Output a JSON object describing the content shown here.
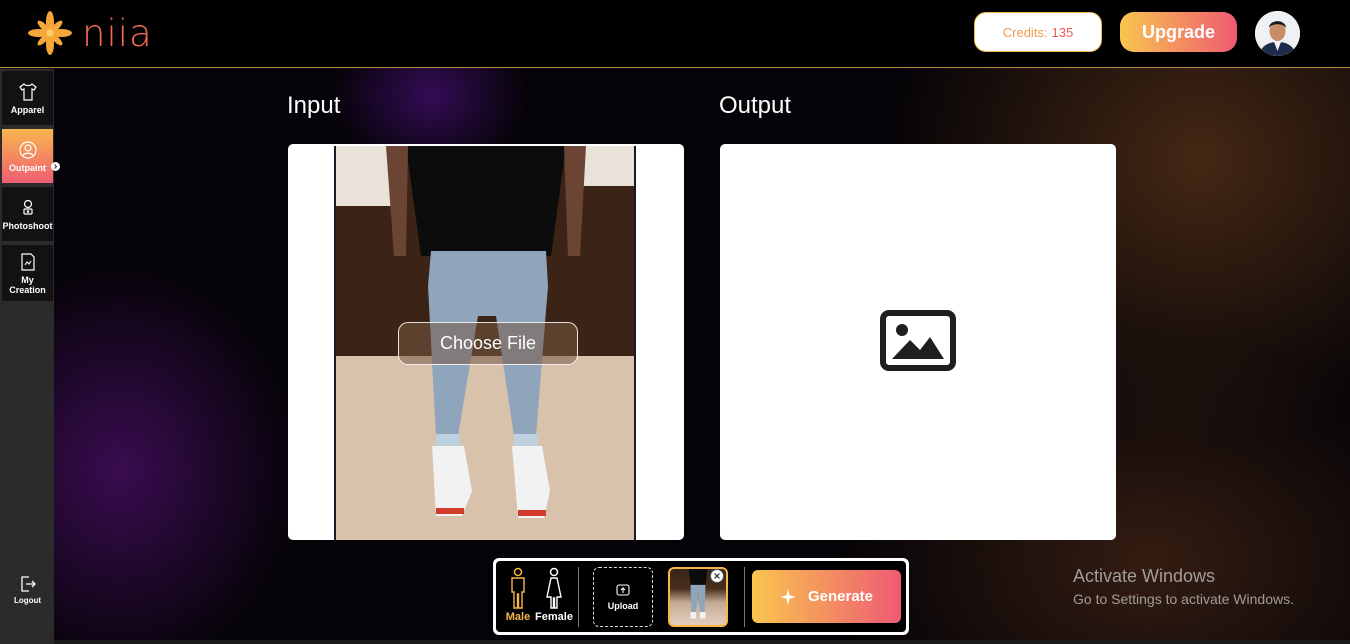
{
  "header": {
    "logo_text": "niia",
    "credits_label": "Credits:",
    "credits_value": "135",
    "upgrade_label": "Upgrade"
  },
  "sidebar": {
    "items": [
      {
        "label": "Apparel",
        "icon": "shirt-icon"
      },
      {
        "label": "Outpaint",
        "icon": "user-circle-icon"
      },
      {
        "label": "Photoshoot",
        "icon": "photoshoot-icon"
      },
      {
        "label_line1": "My",
        "label_line2": "Creation",
        "icon": "creation-icon"
      }
    ],
    "logout_label": "Logout"
  },
  "main": {
    "input_title": "Input",
    "output_title": "Output",
    "choose_file_label": "Choose File"
  },
  "toolbar": {
    "male_label": "Male",
    "female_label": "Female",
    "upload_label": "Upload",
    "generate_label": "Generate"
  },
  "watermark": {
    "title": "Activate Windows",
    "subtitle": "Go to Settings to activate Windows."
  },
  "colors": {
    "accent_start": "#f9c54f",
    "accent_end": "#ef5a72",
    "active_gender": "#f5b748"
  }
}
